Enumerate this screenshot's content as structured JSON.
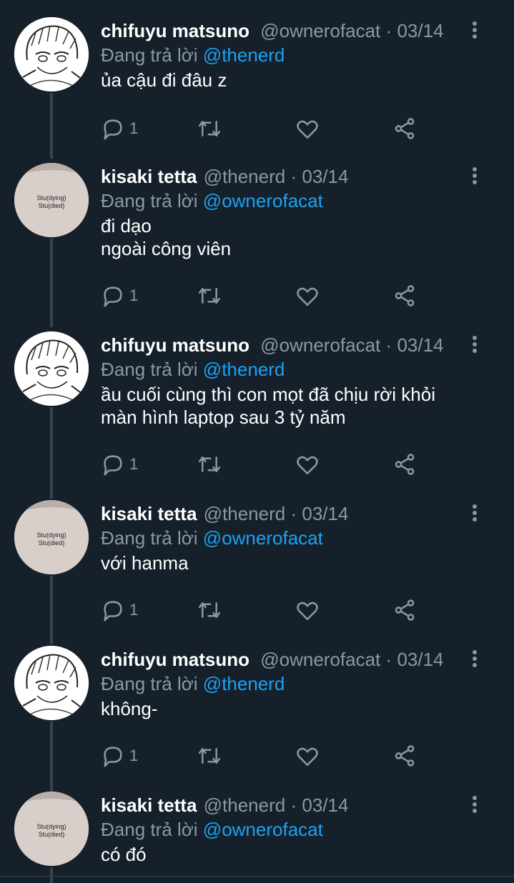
{
  "colors": {
    "background": "#15202b",
    "text_primary": "#ffffff",
    "text_secondary": "#8899a6",
    "mention": "#1da1f2",
    "thread_line": "#38444d"
  },
  "tweets": [
    {
      "name": "chifuyu matsuno",
      "handle": "@ownerofacat",
      "separator": "·",
      "date": "03/14",
      "reply_prefix": "Đang trả lời",
      "reply_mention": "@thenerd",
      "text": "ủa cậu đi đâu z",
      "reply_count": "1",
      "avatar": "manga-boy-avatar"
    },
    {
      "name": "kisaki tetta",
      "handle": "@thenerd",
      "separator": "·",
      "date": "03/14",
      "reply_prefix": "Đang trả lời",
      "reply_mention": "@ownerofacat",
      "text": "đi dạo\nngoài công viên",
      "reply_count": "1",
      "avatar": "shirt-text-avatar",
      "avatar_text": [
        "Stu(dying)",
        "Stu(died)"
      ]
    },
    {
      "name": "chifuyu matsuno",
      "handle": "@ownerofacat",
      "separator": "·",
      "date": "03/14",
      "reply_prefix": "Đang trả lời",
      "reply_mention": "@thenerd",
      "text": "ầu cuối cùng thì con mọt đã chịu rời khỏi\nmàn hình laptop sau 3 tỷ năm",
      "reply_count": "1",
      "avatar": "manga-boy-avatar"
    },
    {
      "name": "kisaki tetta",
      "handle": "@thenerd",
      "separator": "·",
      "date": "03/14",
      "reply_prefix": "Đang trả lời",
      "reply_mention": "@ownerofacat",
      "text": "với hanma",
      "reply_count": "1",
      "avatar": "shirt-text-avatar",
      "avatar_text": [
        "Stu(dying)",
        "Stu(died)"
      ]
    },
    {
      "name": "chifuyu matsuno",
      "handle": "@ownerofacat",
      "separator": "·",
      "date": "03/14",
      "reply_prefix": "Đang trả lời",
      "reply_mention": "@thenerd",
      "text": "không-",
      "reply_count": "1",
      "avatar": "manga-boy-avatar"
    },
    {
      "name": "kisaki tetta",
      "handle": "@thenerd",
      "separator": "·",
      "date": "03/14",
      "reply_prefix": "Đang trả lời",
      "reply_mention": "@ownerofacat",
      "text": "có đó",
      "reply_count": "",
      "avatar": "shirt-text-avatar",
      "avatar_text": [
        "Stu(dying)",
        "Stu(died)"
      ]
    }
  ],
  "icons": {
    "reply": "reply-icon",
    "retweet": "retweet-icon",
    "like": "heart-icon",
    "share": "share-icon",
    "more": "more-icon"
  }
}
